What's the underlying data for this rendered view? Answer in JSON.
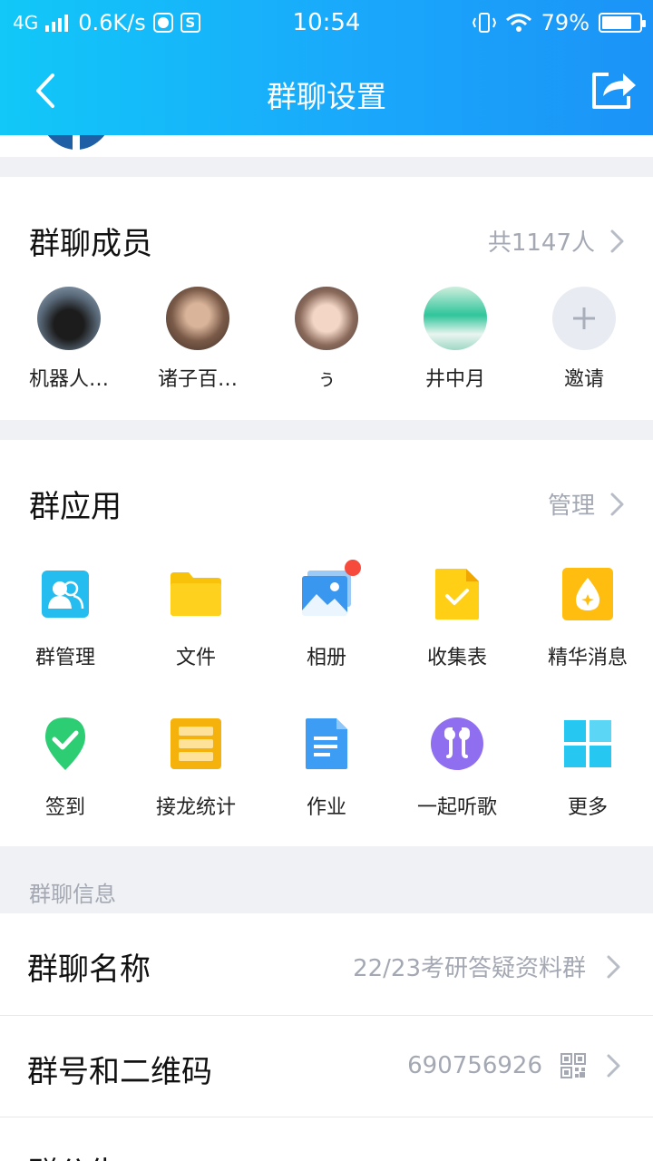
{
  "status_bar": {
    "network": "4G",
    "speed": "0.6K/s",
    "s_badge": "S",
    "time": "10:54",
    "battery_percent": "79%",
    "battery_level": 0.79
  },
  "nav": {
    "title": "群聊设置"
  },
  "members": {
    "title": "群聊成员",
    "count": "共1147人",
    "list": [
      {
        "name": "机器人…"
      },
      {
        "name": "诸子百…"
      },
      {
        "name": "ぅ"
      },
      {
        "name": "井中月"
      }
    ],
    "invite_label": "邀请"
  },
  "apps": {
    "title": "群应用",
    "manage": "管理",
    "items": [
      {
        "label": "群管理",
        "icon": "group-manage-icon"
      },
      {
        "label": "文件",
        "icon": "folder-icon"
      },
      {
        "label": "相册",
        "icon": "album-icon"
      },
      {
        "label": "收集表",
        "icon": "collect-form-icon"
      },
      {
        "label": "精华消息",
        "icon": "essence-icon"
      },
      {
        "label": "签到",
        "icon": "checkin-icon"
      },
      {
        "label": "接龙统计",
        "icon": "relay-stats-icon"
      },
      {
        "label": "作业",
        "icon": "homework-icon"
      },
      {
        "label": "一起听歌",
        "icon": "music-icon"
      },
      {
        "label": "更多",
        "icon": "more-grid-icon"
      }
    ]
  },
  "info": {
    "header": "群聊信息",
    "name_label": "群聊名称",
    "name_value": "22/23考研答疑资料群",
    "id_label": "群号和二维码",
    "id_value": "690756926",
    "notice_label": "群公告"
  },
  "colors": {
    "header_start": "#11c8f8",
    "header_end": "#1b93f7",
    "muted": "#a3a8b3",
    "badge_red": "#f64a3d"
  }
}
